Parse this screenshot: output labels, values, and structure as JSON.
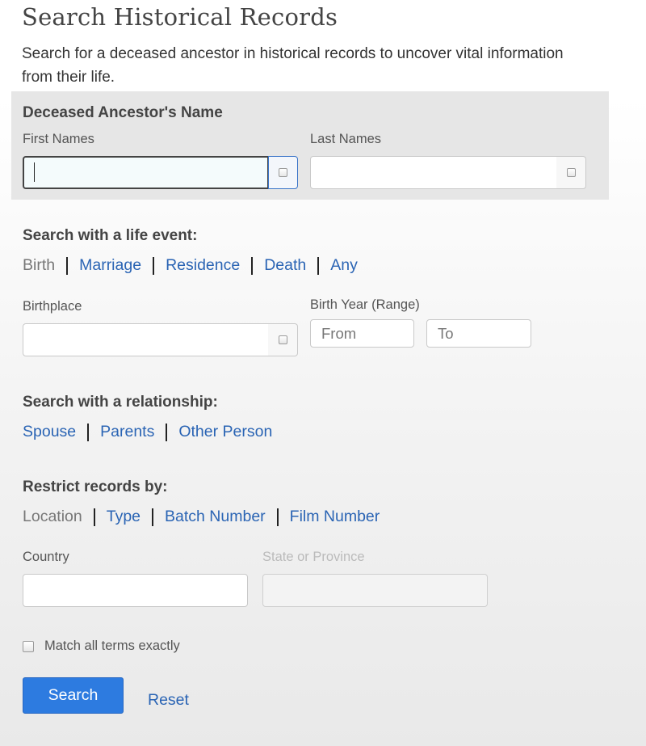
{
  "page": {
    "title": "Search Historical Records",
    "intro": "Search for a deceased ancestor in historical records to uncover vital information from their life."
  },
  "name_section": {
    "heading": "Deceased Ancestor's Name",
    "first_names_label": "First Names",
    "first_names_value": "",
    "last_names_label": "Last Names",
    "last_names_value": ""
  },
  "life_event": {
    "heading": "Search with a life event:",
    "tabs": [
      "Birth",
      "Marriage",
      "Residence",
      "Death",
      "Any"
    ],
    "active_tab": "Birth",
    "birthplace_label": "Birthplace",
    "birthplace_value": "",
    "birth_year_label": "Birth Year (Range)",
    "from_placeholder": "From",
    "to_placeholder": "To"
  },
  "relationship": {
    "heading": "Search with a relationship:",
    "links": [
      "Spouse",
      "Parents",
      "Other Person"
    ]
  },
  "restrict": {
    "heading": "Restrict records by:",
    "tabs": [
      "Location",
      "Type",
      "Batch Number",
      "Film Number"
    ],
    "active_tab": "Location",
    "country_label": "Country",
    "country_value": "",
    "state_label": "State or Province",
    "state_value": ""
  },
  "options": {
    "match_exact_label": "Match all terms exactly",
    "match_exact_checked": false
  },
  "actions": {
    "search_label": "Search",
    "reset_label": "Reset"
  },
  "colors": {
    "link": "#2a64b4",
    "primary_button": "#2d7be0",
    "name_panel_bg": "#e6e6e6"
  }
}
